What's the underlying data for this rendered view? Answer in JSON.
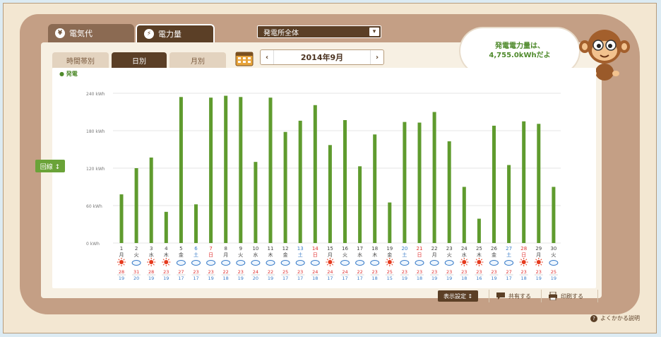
{
  "tabs": {
    "cost": "電気代",
    "power": "電力量"
  },
  "plant_select": "発電所全体",
  "subtabs": {
    "hourly": "時間帯別",
    "daily": "日別",
    "monthly": "月別"
  },
  "date_label": "2014年9月",
  "bubble": {
    "line1": "発電電力量は、",
    "line2": "4,755.0kWhだよ"
  },
  "legend_label": "発電",
  "unit_button": "回線 ↕",
  "toolbar": {
    "display": "表示設定 ↕",
    "share": "共有する",
    "print": "印刷する"
  },
  "help": "よくかかる説明",
  "colors": {
    "bar": "#5f9b2e",
    "brown": "#5b3f26",
    "sunday": "#e03030",
    "saturday": "#3a7cc8"
  },
  "chart_data": {
    "type": "bar",
    "ylabel": "",
    "ylim": [
      0,
      240
    ],
    "yticks": [
      "240 kWh",
      "180 kWh",
      "120 kWh",
      "60 kWh",
      "0 kWh"
    ],
    "categories": [
      "1",
      "2",
      "3",
      "4",
      "5",
      "6",
      "7",
      "8",
      "9",
      "10",
      "11",
      "12",
      "13",
      "14",
      "15",
      "16",
      "17",
      "18",
      "19",
      "20",
      "21",
      "22",
      "23",
      "24",
      "25",
      "26",
      "27",
      "28",
      "29",
      "30"
    ],
    "weekdays": [
      "月",
      "火",
      "水",
      "木",
      "金",
      "土",
      "日",
      "月",
      "火",
      "水",
      "木",
      "金",
      "土",
      "日",
      "月",
      "火",
      "水",
      "木",
      "金",
      "土",
      "日",
      "月",
      "火",
      "水",
      "木",
      "金",
      "土",
      "日",
      "月",
      "火"
    ],
    "series": [
      {
        "values": [
          78,
          120,
          137,
          50,
          234,
          62,
          233,
          236,
          234,
          130,
          233,
          178,
          196,
          221,
          157,
          197,
          123,
          174,
          65,
          194,
          193,
          210,
          163,
          90,
          39,
          188,
          125,
          195,
          191,
          90
        ]
      }
    ],
    "weather": [
      "sun",
      "cloud",
      "sun",
      "sun",
      "cloud",
      "cloud",
      "cloud",
      "cloud",
      "cloud",
      "cloud",
      "cloud",
      "cloud",
      "cloud",
      "cloud",
      "sun",
      "cloud",
      "cloud",
      "cloud",
      "sun",
      "cloud",
      "cloud",
      "cloud",
      "cloud",
      "sun",
      "sun",
      "cloud",
      "cloud",
      "sun",
      "sun",
      "cloud"
    ],
    "temp_high": [
      "28",
      "31",
      "28",
      "23",
      "27",
      "23",
      "23",
      "22",
      "23",
      "24",
      "22",
      "25",
      "23",
      "24",
      "24",
      "24",
      "22",
      "23",
      "25",
      "23",
      "23",
      "23",
      "23",
      "23",
      "23",
      "23",
      "27",
      "23",
      "23",
      "25"
    ],
    "temp_low": [
      "19",
      "20",
      "19",
      "19",
      "17",
      "17",
      "19",
      "18",
      "19",
      "20",
      "19",
      "17",
      "17",
      "18",
      "17",
      "17",
      "17",
      "18",
      "15",
      "19",
      "18",
      "19",
      "19",
      "18",
      "16",
      "19",
      "17",
      "18",
      "19",
      "19"
    ]
  }
}
